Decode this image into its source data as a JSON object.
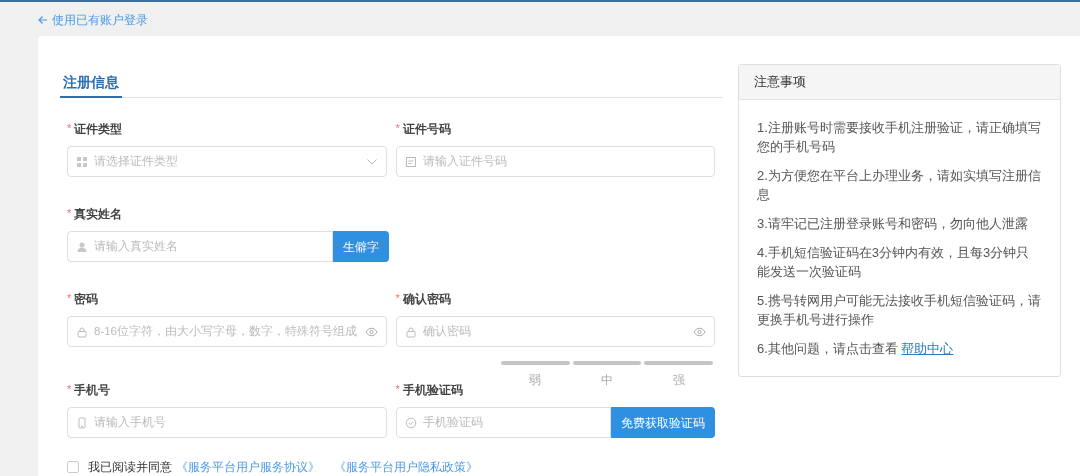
{
  "back_link": {
    "text": "使用已有账户登录"
  },
  "tabs": [
    {
      "label": "注册信息",
      "selected": true
    }
  ],
  "rows": [
    {
      "fields": [
        {
          "kind": "select",
          "label": "证件类型",
          "mark": "*",
          "placeholder": "请选择证件类型"
        },
        {
          "kind": "text",
          "label": "证件号码",
          "mark": "*",
          "placeholder": "请输入证件号码"
        }
      ]
    },
    {
      "fields": [
        {
          "kind": "button",
          "label": "真实姓名",
          "mark": "*",
          "placeholder": "请输入真实姓名",
          "button": "生僻字"
        }
      ]
    },
    {
      "fields": [
        {
          "kind": "password",
          "label": "密码",
          "mark": "*",
          "placeholder": "8-16位字符，由大小写字母，数字，特殊符号组成"
        },
        {
          "kind": "password",
          "label": "确认密码",
          "mark": "*",
          "placeholder": "确认密码"
        }
      ]
    },
    {
      "fields": [
        {
          "kind": "text",
          "label": "手机号",
          "mark": "*",
          "placeholder": "请输入手机号"
        },
        {
          "kind": "button",
          "label": "手机验证码",
          "mark": "*",
          "placeholder": "手机验证码",
          "button": "免费获取验证码"
        }
      ]
    }
  ],
  "password_strength": {
    "labels": [
      "弱",
      "中",
      "强"
    ]
  },
  "agreement": {
    "checked": false,
    "text": "我已阅读并同意",
    "links": [
      "《服务平台用户服务协议》",
      "《服务平台用户隐私政策》"
    ]
  },
  "notice": {
    "title": "注意事项",
    "items": [
      {
        "text": "1.注册账号时需要接收手机注册验证，请正确填写您的手机号码"
      },
      {
        "text": "2.为方便您在平台上办理业务，请如实填写注册信息"
      },
      {
        "text": "3.请牢记已注册登录账号和密码，勿向他人泄露"
      },
      {
        "text": "4.手机短信验证码在3分钟内有效，且每3分钟只能发送一次验证码"
      },
      {
        "text": "5.携号转网用户可能无法接收手机短信验证码，请更换手机号进行操作"
      },
      {
        "text": "6.其他问题，请点击查看",
        "link": "帮助中心"
      }
    ]
  }
}
